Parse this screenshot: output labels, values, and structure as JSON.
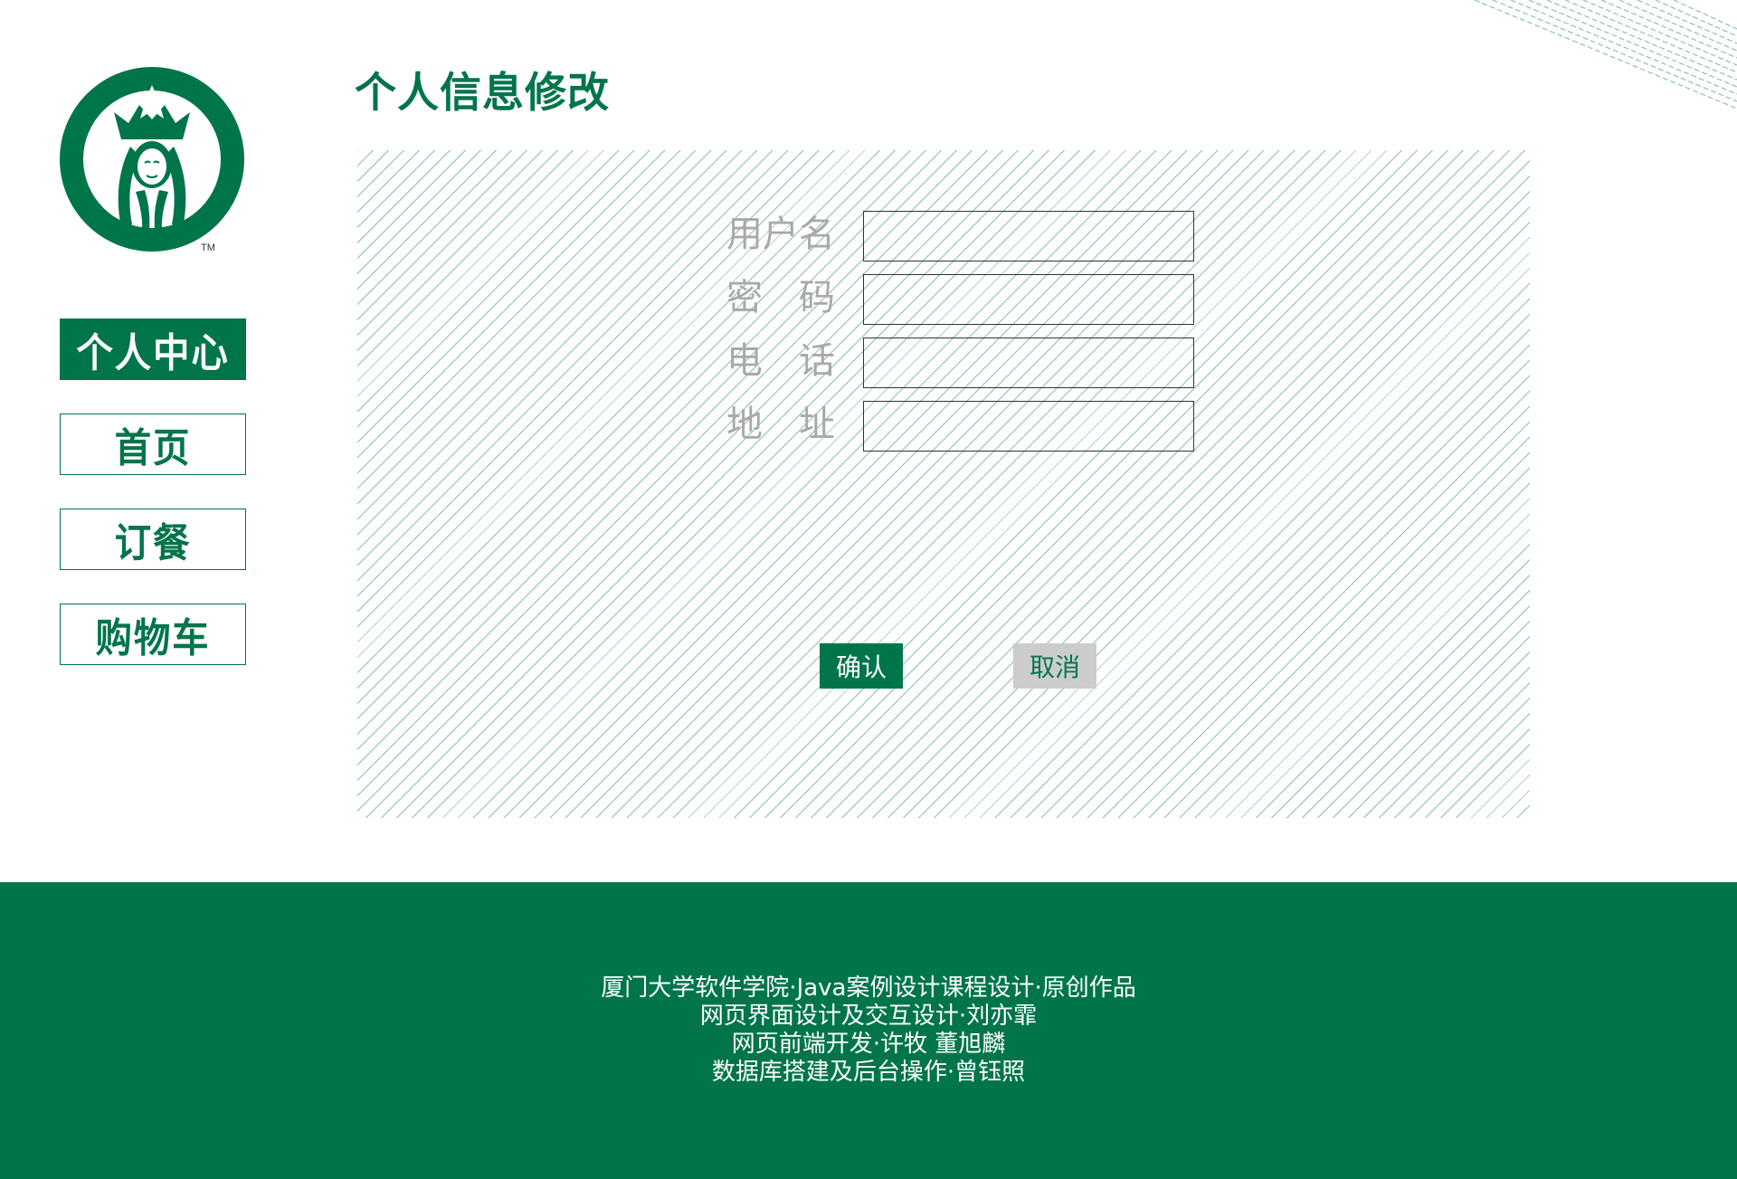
{
  "colors": {
    "brand_green": "#00754a",
    "label_gray": "#a9a9a9",
    "cancel_bg": "#cccccc"
  },
  "logo": {
    "icon": "starbucks-siren-logo-icon",
    "trademark": "TM"
  },
  "sidebar": {
    "items": [
      {
        "label": "个人中心",
        "active": true
      },
      {
        "label": "首页",
        "active": false
      },
      {
        "label": "订餐",
        "active": false
      },
      {
        "label": "购物车",
        "active": false
      }
    ]
  },
  "page": {
    "title": "个人信息修改"
  },
  "form": {
    "fields": [
      {
        "label": "用户名",
        "value": ""
      },
      {
        "label": "密码",
        "value": ""
      },
      {
        "label": "电话",
        "value": ""
      },
      {
        "label": "地址",
        "value": ""
      }
    ],
    "confirm_label": "确认",
    "cancel_label": "取消"
  },
  "footer": {
    "lines": [
      "厦门大学软件学院·Java案例设计课程设计·原创作品",
      "网页界面设计及交互设计·刘亦霏",
      "网页前端开发·许牧 董旭麟",
      "数据库搭建及后台操作·曾钰照"
    ]
  }
}
